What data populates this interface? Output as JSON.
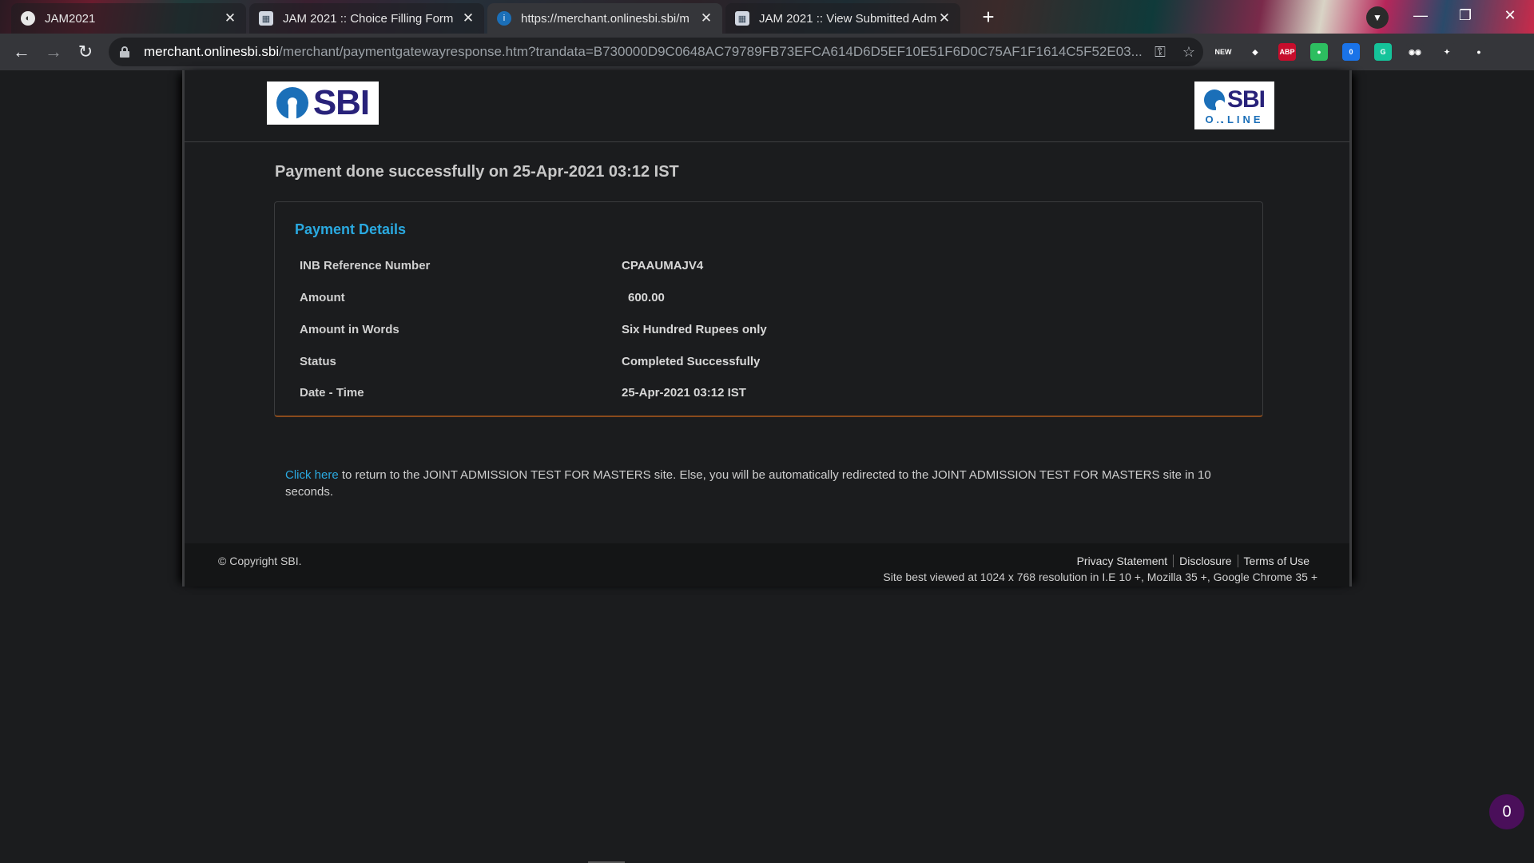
{
  "browser": {
    "tabs": [
      {
        "title": "JAM2021",
        "active": false,
        "favicon": "globe-icon"
      },
      {
        "title": "JAM 2021 :: Choice Filling Form",
        "active": false,
        "favicon": "jam-logo-icon"
      },
      {
        "title": "https://merchant.onlinesbi.sbi/m",
        "active": true,
        "favicon": "sbi-icon"
      },
      {
        "title": "JAM 2021 :: View Submitted Adm",
        "active": false,
        "favicon": "jam-logo-icon"
      }
    ],
    "new_tab_label": "+",
    "url_domain": "merchant.onlinesbi.sbi",
    "url_path": "/merchant/paymentgatewayresponse.htm?trandata=B730000D9C0648AC79789FB73EFCA614D6D5EF10E51F6D0C75AF1F1614C5F52E03...",
    "extensions": [
      {
        "name": "new-extension-icon",
        "label": "NEW",
        "color": "#35363a"
      },
      {
        "name": "diamond-extension-icon",
        "label": "◆",
        "color": "#35363a"
      },
      {
        "name": "adblock-plus-icon",
        "label": "ABP",
        "color": "#c70d2c"
      },
      {
        "name": "evernote-icon",
        "label": "●",
        "color": "#2dbe60"
      },
      {
        "name": "extension-badge-icon",
        "label": "0",
        "color": "#1a73e8"
      },
      {
        "name": "grammarly-icon",
        "label": "G",
        "color": "#15c39a"
      },
      {
        "name": "spy-extension-icon",
        "label": "◉◉",
        "color": "#35363a"
      },
      {
        "name": "extensions-puzzle-icon",
        "label": "✦",
        "color": "#35363a"
      },
      {
        "name": "profile-icon",
        "label": "●",
        "color": "#35363a"
      }
    ]
  },
  "page": {
    "logo_left": "SBI",
    "logo_right_top": "SBI",
    "logo_right_bottom": "ONLINE",
    "success_heading": "Payment done successfully on 25-Apr-2021 03:12 IST",
    "details_title": "Payment Details",
    "rows": [
      {
        "label": "INB Reference Number",
        "value": "CPAAUMAJV4"
      },
      {
        "label": "Amount",
        "value": "600.00"
      },
      {
        "label": "Amount in Words",
        "value": "Six Hundred Rupees only"
      },
      {
        "label": "Status",
        "value": "Completed Successfully"
      },
      {
        "label": "Date - Time",
        "value": "25-Apr-2021 03:12 IST"
      }
    ],
    "redirect_link": "Click here",
    "redirect_text": " to return to the JOINT ADMISSION TEST FOR MASTERS site. Else, you will be automatically redirected to the JOINT ADMISSION TEST FOR MASTERS site in 10 seconds."
  },
  "footer": {
    "copyright": "© Copyright SBI.",
    "links": [
      "Privacy Statement",
      "Disclosure",
      "Terms of Use"
    ],
    "best_viewed": "Site best viewed at 1024 x 768 resolution in I.E 10 +, Mozilla 35 +, Google Chrome 35 +"
  },
  "notification_count": "0",
  "colors": {
    "accent_link": "#2aa9e0",
    "sbi_blue": "#1b6fb8",
    "sbi_navy": "#28227a"
  }
}
